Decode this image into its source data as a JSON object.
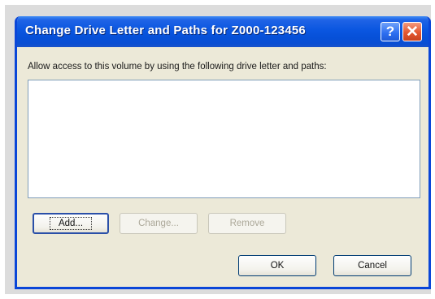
{
  "window": {
    "title": "Change Drive Letter and Paths for Z000-123456",
    "help_glyph": "?",
    "close_glyph": "✕"
  },
  "dialog": {
    "prompt": "Allow access to this volume by using the following drive letter and paths:",
    "paths_list": []
  },
  "buttons": {
    "add": "Add...",
    "change": "Change...",
    "remove": "Remove",
    "ok": "OK",
    "cancel": "Cancel"
  }
}
